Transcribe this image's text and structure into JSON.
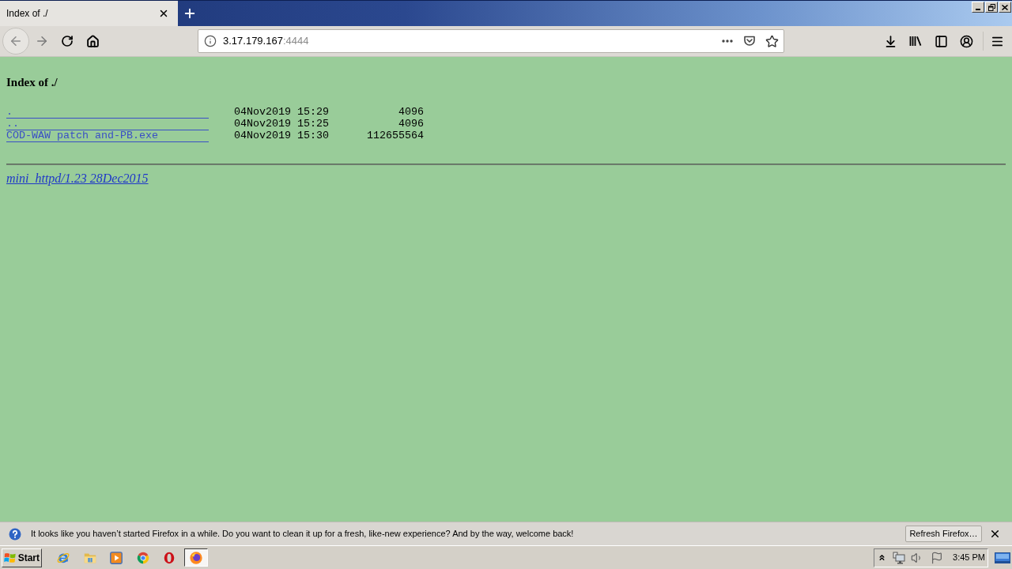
{
  "browser": {
    "tabs": [
      {
        "title": "Index of ./",
        "selected": true
      }
    ],
    "navigation": {
      "back_disabled": true,
      "forward_disabled": true
    },
    "address_bar": {
      "host": "3.17.179.167",
      "port": ":4444"
    }
  },
  "page": {
    "heading": "Index of ./",
    "entries": [
      {
        "name": ".",
        "modified": "04Nov2019 15:29",
        "size": "4096"
      },
      {
        "name": "..",
        "modified": "04Nov2019 15:25",
        "size": "4096"
      },
      {
        "name": "COD-WAW patch and-PB.exe",
        "modified": "04Nov2019 15:30",
        "size": "112655564"
      }
    ],
    "footer_link": "mini_httpd/1.23 28Dec2015"
  },
  "notification": {
    "message": "It looks like you haven’t started Firefox in a while. Do you want to clean it up for a fresh, like-new experience? And by the way, welcome back!",
    "button": "Refresh Firefox…"
  },
  "taskbar": {
    "start": "Start",
    "apps": [
      {
        "kind": "ie",
        "selected": false
      },
      {
        "kind": "explorer",
        "selected": false
      },
      {
        "kind": "media",
        "selected": false
      },
      {
        "kind": "chrome",
        "selected": false
      },
      {
        "kind": "opera",
        "selected": false
      },
      {
        "kind": "firefox",
        "selected": true
      }
    ],
    "clock": "3:45 PM"
  }
}
